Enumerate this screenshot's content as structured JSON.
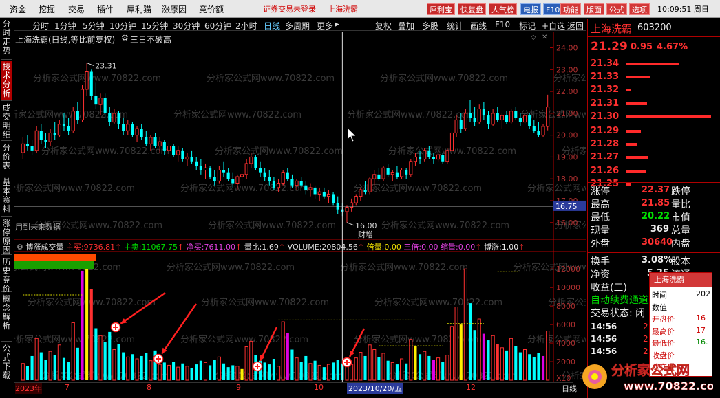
{
  "menubar": {
    "items": [
      "资金",
      "挖掘",
      "交易",
      "插件",
      "犀利猫",
      "涨原因",
      "竞价额"
    ],
    "warning": "证券交易未登录",
    "stock_link": "上海洗霸",
    "tool_buttons": [
      "犀利宝",
      "快复盘",
      "人气榜",
      "电报",
      "F10",
      "功能",
      "版面",
      "公式",
      "选项"
    ],
    "time": "10:09:51 周日"
  },
  "left_tabs": [
    "分时走势",
    "技术分析",
    "成交明细",
    "分价表",
    "基本资料",
    "涨停原因",
    "历史竞价",
    "概念解析",
    "公式下载"
  ],
  "left_tab_active": 1,
  "period_bar": {
    "periods": [
      "分时",
      "1分钟",
      "5分钟",
      "10分钟",
      "15分钟",
      "30分钟",
      "60分钟",
      "2小时",
      "日线",
      "多周期",
      "更多"
    ],
    "selected": "日线",
    "more_arrow": "▶",
    "right_items": [
      "复权",
      "叠加",
      "多股",
      "统计",
      "画线",
      "F10",
      "标记",
      "+自选",
      "返回"
    ]
  },
  "chart_header": {
    "title": "上海洗霸(日线,等比前复权)",
    "indicator": "三日不破高"
  },
  "right_panel": {
    "name": "上海洗霸",
    "code": "603200",
    "price": "21.29",
    "change": "0.95",
    "change_pct": "4.67%",
    "order_book": [
      {
        "price": "21.34",
        "bar": 0.6,
        "kind": "ask"
      },
      {
        "price": "21.33",
        "bar": 0.28,
        "kind": "ask"
      },
      {
        "price": "21.32",
        "bar": 0.06,
        "kind": "ask"
      },
      {
        "price": "21.31",
        "bar": 0.24,
        "kind": "ask"
      },
      {
        "price": "21.30",
        "bar": 0.95,
        "kind": "ask"
      },
      {
        "price": "21.29",
        "bar": 0.17,
        "kind": "bid"
      },
      {
        "price": "21.28",
        "bar": 0.12,
        "kind": "bid"
      },
      {
        "price": "21.27",
        "bar": 0.25,
        "kind": "bid"
      },
      {
        "price": "21.26",
        "bar": 0.22,
        "kind": "bid"
      },
      {
        "price": "21.25",
        "bar": 0.05,
        "kind": "bid"
      }
    ],
    "stats": [
      {
        "l1": "涨停",
        "v1": "22.37",
        "c1": "red",
        "l2": "跌停"
      },
      {
        "l1": "最高",
        "v1": "21.85",
        "c1": "red",
        "l2": "量比"
      },
      {
        "l1": "最低",
        "v1": "20.22",
        "c1": "green",
        "l2": "市值"
      },
      {
        "l1": "现量",
        "v1": "369",
        "c1": "white",
        "l2": "总量"
      },
      {
        "l1": "外盘",
        "v1": "30640",
        "c1": "red",
        "l2": "内盘"
      }
    ],
    "stats2": [
      {
        "l1": "换手",
        "v1": "3.08%",
        "l2": "股本"
      },
      {
        "l1": "净资",
        "v1": "5.35",
        "l2": "流通"
      },
      {
        "l1": "收益(三)",
        "v1": "0",
        "l2": ""
      }
    ],
    "notice": "自动续费通道",
    "trade_state": "交易状态: 闭",
    "ticks": [
      "14:56",
      "14:56",
      "14:56"
    ],
    "tick_vals": [
      "2",
      "2",
      "2"
    ]
  },
  "popup": {
    "title": "上海洗霸",
    "rows": [
      {
        "label": "时间",
        "value": "202"
      },
      {
        "label": "数值",
        "value": ""
      },
      {
        "label": "开盘价",
        "value": "16"
      },
      {
        "label": "最高价",
        "value": "17"
      },
      {
        "label": "最低价",
        "value": "16."
      },
      {
        "label": "收盘价",
        "value": ""
      },
      {
        "label": "成交量",
        "value": ""
      }
    ]
  },
  "main_chart": {
    "yticks": [
      "24.00",
      "23.00",
      "22.00",
      "21.00",
      "20.00",
      "19.00",
      "18.00",
      "17.00",
      "16.00"
    ],
    "high_label": "23.31",
    "low_label": "16.00",
    "crosshair_price": "16.75",
    "event_label": "财增",
    "future_note": "用到未来数据",
    "watermark": "分析家公式网www.70822.com"
  },
  "vol_header": {
    "name": "博涨成交量",
    "main_buy_label": "主买:",
    "main_buy": "9736.81",
    "main_sell_label": "主卖:",
    "main_sell": "11067.75",
    "net_buy_label": "净买:",
    "net_buy": "7611.00",
    "ratio_label": "量比:",
    "ratio": "1.69",
    "volume_label": "VOLUME:",
    "volume": "20804.56",
    "bei_label": "倍量:",
    "bei": "0.00",
    "san_label": "三倍:",
    "san": "0.00",
    "suo_label": "缩量:",
    "suo": "0.00",
    "bo_label": "博涨:",
    "bo": "1.00"
  },
  "vol_axis": {
    "ticks": [
      "12000",
      "10000",
      "8000",
      "6000",
      "4000",
      "2000"
    ],
    "unit": "X10"
  },
  "time_axis": {
    "labels": [
      "2023年",
      "7",
      "8",
      "9",
      "10",
      "12"
    ],
    "cross_date": "2023/10/20/五",
    "right_label": "日线"
  },
  "logo_text": "分析家公式网",
  "logo_url": "www.70822.com",
  "chart_data": {
    "type": "candlestick",
    "title": "上海洗霸(日线,等比前复权)",
    "ylim": [
      15.3,
      24.3
    ],
    "vol_ylim": [
      0,
      13500
    ],
    "candles": [
      {
        "o": 19.2,
        "h": 19.9,
        "l": 18.9,
        "c": 19.6,
        "v": 1800
      },
      {
        "o": 19.6,
        "h": 20.0,
        "l": 19.3,
        "c": 19.5,
        "v": 1500
      },
      {
        "o": 19.5,
        "h": 19.8,
        "l": 19.1,
        "c": 19.3,
        "v": 2600
      },
      {
        "o": 19.3,
        "h": 20.4,
        "l": 19.2,
        "c": 20.2,
        "v": 4500
      },
      {
        "o": 20.2,
        "h": 20.5,
        "l": 19.6,
        "c": 19.8,
        "v": 3000
      },
      {
        "o": 19.8,
        "h": 20.1,
        "l": 19.4,
        "c": 19.7,
        "v": 2200
      },
      {
        "o": 19.7,
        "h": 20.3,
        "l": 19.5,
        "c": 20.1,
        "v": 3100
      },
      {
        "o": 20.1,
        "h": 20.6,
        "l": 19.8,
        "c": 20.0,
        "v": 2700
      },
      {
        "o": 20.0,
        "h": 20.7,
        "l": 19.9,
        "c": 20.5,
        "v": 3800
      },
      {
        "o": 20.5,
        "h": 21.0,
        "l": 20.2,
        "c": 20.4,
        "v": 2400
      },
      {
        "o": 20.4,
        "h": 20.8,
        "l": 20.0,
        "c": 20.2,
        "v": 2000
      },
      {
        "o": 20.2,
        "h": 21.3,
        "l": 20.1,
        "c": 21.1,
        "v": 6200
      },
      {
        "o": 21.1,
        "h": 21.5,
        "l": 20.5,
        "c": 20.7,
        "v": 3500
      },
      {
        "o": 20.7,
        "h": 22.3,
        "l": 20.6,
        "c": 22.1,
        "v": 11800
      },
      {
        "o": 22.1,
        "h": 23.31,
        "l": 21.8,
        "c": 22.9,
        "v": 13000
      },
      {
        "o": 22.9,
        "h": 23.0,
        "l": 21.6,
        "c": 21.8,
        "v": 9800
      },
      {
        "o": 21.8,
        "h": 22.4,
        "l": 21.2,
        "c": 21.4,
        "v": 5600
      },
      {
        "o": 21.4,
        "h": 21.9,
        "l": 20.9,
        "c": 21.7,
        "v": 4800
      },
      {
        "o": 21.7,
        "h": 21.9,
        "l": 20.8,
        "c": 21.0,
        "v": 4100
      },
      {
        "o": 21.0,
        "h": 21.3,
        "l": 20.4,
        "c": 20.6,
        "v": 5200
      },
      {
        "o": 20.6,
        "h": 21.2,
        "l": 20.5,
        "c": 21.0,
        "v": 3300
      },
      {
        "o": 21.0,
        "h": 21.1,
        "l": 20.3,
        "c": 20.5,
        "v": 3900
      },
      {
        "o": 20.5,
        "h": 20.8,
        "l": 20.0,
        "c": 20.2,
        "v": 3000
      },
      {
        "o": 20.2,
        "h": 20.7,
        "l": 20.0,
        "c": 20.5,
        "v": 2500
      },
      {
        "o": 20.5,
        "h": 20.6,
        "l": 19.9,
        "c": 20.0,
        "v": 2800
      },
      {
        "o": 20.0,
        "h": 20.4,
        "l": 19.7,
        "c": 20.3,
        "v": 2300
      },
      {
        "o": 20.3,
        "h": 20.5,
        "l": 19.8,
        "c": 19.9,
        "v": 2600
      },
      {
        "o": 19.9,
        "h": 20.2,
        "l": 19.5,
        "c": 19.6,
        "v": 2900
      },
      {
        "o": 19.6,
        "h": 20.0,
        "l": 19.3,
        "c": 19.9,
        "v": 2100
      },
      {
        "o": 19.9,
        "h": 20.1,
        "l": 19.4,
        "c": 19.5,
        "v": 3200
      },
      {
        "o": 19.5,
        "h": 19.9,
        "l": 19.2,
        "c": 19.7,
        "v": 1700
      },
      {
        "o": 19.7,
        "h": 19.8,
        "l": 19.1,
        "c": 19.3,
        "v": 1900
      },
      {
        "o": 19.3,
        "h": 19.7,
        "l": 19.0,
        "c": 19.5,
        "v": 1600
      },
      {
        "o": 19.5,
        "h": 19.6,
        "l": 19.0,
        "c": 19.1,
        "v": 2000
      },
      {
        "o": 19.1,
        "h": 19.5,
        "l": 18.8,
        "c": 19.3,
        "v": 1400
      },
      {
        "o": 19.3,
        "h": 19.4,
        "l": 18.8,
        "c": 18.9,
        "v": 1800
      },
      {
        "o": 18.9,
        "h": 19.2,
        "l": 18.6,
        "c": 19.0,
        "v": 1500
      },
      {
        "o": 19.0,
        "h": 19.3,
        "l": 18.7,
        "c": 18.8,
        "v": 1300
      },
      {
        "o": 18.8,
        "h": 19.0,
        "l": 18.4,
        "c": 18.6,
        "v": 1700
      },
      {
        "o": 18.6,
        "h": 18.9,
        "l": 18.2,
        "c": 18.4,
        "v": 2100
      },
      {
        "o": 18.4,
        "h": 18.7,
        "l": 18.0,
        "c": 18.5,
        "v": 1900
      },
      {
        "o": 18.5,
        "h": 18.6,
        "l": 18.0,
        "c": 18.1,
        "v": 1600
      },
      {
        "o": 18.1,
        "h": 18.4,
        "l": 17.7,
        "c": 17.9,
        "v": 2200
      },
      {
        "o": 17.9,
        "h": 18.6,
        "l": 17.8,
        "c": 18.4,
        "v": 2500
      },
      {
        "o": 18.4,
        "h": 18.8,
        "l": 18.1,
        "c": 18.3,
        "v": 1800
      },
      {
        "o": 18.3,
        "h": 18.5,
        "l": 17.9,
        "c": 18.0,
        "v": 1400
      },
      {
        "o": 18.0,
        "h": 18.3,
        "l": 17.6,
        "c": 17.8,
        "v": 1600
      },
      {
        "o": 17.8,
        "h": 18.2,
        "l": 17.5,
        "c": 18.1,
        "v": 1500
      },
      {
        "o": 18.1,
        "h": 18.4,
        "l": 17.9,
        "c": 18.2,
        "v": 1200
      },
      {
        "o": 18.2,
        "h": 18.9,
        "l": 18.0,
        "c": 18.7,
        "v": 3600
      },
      {
        "o": 18.7,
        "h": 19.2,
        "l": 18.5,
        "c": 19.0,
        "v": 4200
      },
      {
        "o": 19.0,
        "h": 19.1,
        "l": 18.4,
        "c": 18.5,
        "v": 2700
      },
      {
        "o": 18.5,
        "h": 18.8,
        "l": 18.1,
        "c": 18.3,
        "v": 2100
      },
      {
        "o": 18.3,
        "h": 18.5,
        "l": 17.9,
        "c": 18.1,
        "v": 1900
      },
      {
        "o": 18.1,
        "h": 18.4,
        "l": 17.7,
        "c": 17.9,
        "v": 1700
      },
      {
        "o": 17.9,
        "h": 18.1,
        "l": 17.5,
        "c": 17.6,
        "v": 2300
      },
      {
        "o": 17.6,
        "h": 18.0,
        "l": 17.4,
        "c": 17.8,
        "v": 1500
      },
      {
        "o": 17.8,
        "h": 18.4,
        "l": 17.7,
        "c": 18.3,
        "v": 6300
      },
      {
        "o": 18.3,
        "h": 18.5,
        "l": 17.9,
        "c": 18.0,
        "v": 5100
      },
      {
        "o": 18.0,
        "h": 18.2,
        "l": 17.6,
        "c": 17.7,
        "v": 3300
      },
      {
        "o": 17.7,
        "h": 18.0,
        "l": 17.5,
        "c": 17.9,
        "v": 2400
      },
      {
        "o": 17.9,
        "h": 18.1,
        "l": 17.6,
        "c": 17.7,
        "v": 2000
      },
      {
        "o": 17.7,
        "h": 17.9,
        "l": 17.3,
        "c": 17.5,
        "v": 2600
      },
      {
        "o": 17.5,
        "h": 17.8,
        "l": 17.2,
        "c": 17.6,
        "v": 1800
      },
      {
        "o": 17.6,
        "h": 17.7,
        "l": 17.1,
        "c": 17.3,
        "v": 2100
      },
      {
        "o": 17.3,
        "h": 17.6,
        "l": 17.0,
        "c": 17.4,
        "v": 1600
      },
      {
        "o": 17.4,
        "h": 17.6,
        "l": 17.1,
        "c": 17.2,
        "v": 1400
      },
      {
        "o": 17.2,
        "h": 17.5,
        "l": 16.9,
        "c": 17.3,
        "v": 1700
      },
      {
        "o": 17.3,
        "h": 17.4,
        "l": 16.8,
        "c": 16.9,
        "v": 1900
      },
      {
        "o": 16.9,
        "h": 17.2,
        "l": 16.4,
        "c": 16.6,
        "v": 2200
      },
      {
        "o": 16.6,
        "h": 16.9,
        "l": 16.3,
        "c": 16.5,
        "v": 1800
      },
      {
        "o": 16.5,
        "h": 16.8,
        "l": 16.0,
        "c": 16.7,
        "v": 2000
      },
      {
        "o": 16.7,
        "h": 17.1,
        "l": 16.5,
        "c": 16.9,
        "v": 1700
      },
      {
        "o": 16.9,
        "h": 17.3,
        "l": 16.8,
        "c": 17.2,
        "v": 2400
      },
      {
        "o": 17.2,
        "h": 17.6,
        "l": 17.0,
        "c": 17.5,
        "v": 3000
      },
      {
        "o": 17.5,
        "h": 17.9,
        "l": 17.3,
        "c": 17.4,
        "v": 2600
      },
      {
        "o": 17.4,
        "h": 18.1,
        "l": 17.3,
        "c": 18.0,
        "v": 3800
      },
      {
        "o": 18.0,
        "h": 18.4,
        "l": 17.7,
        "c": 18.2,
        "v": 3300
      },
      {
        "o": 18.2,
        "h": 18.5,
        "l": 17.9,
        "c": 18.0,
        "v": 2500
      },
      {
        "o": 18.0,
        "h": 18.6,
        "l": 17.9,
        "c": 18.5,
        "v": 2900
      },
      {
        "o": 18.5,
        "h": 18.7,
        "l": 18.1,
        "c": 18.2,
        "v": 2100
      },
      {
        "o": 18.2,
        "h": 18.4,
        "l": 17.9,
        "c": 18.3,
        "v": 1900
      },
      {
        "o": 18.3,
        "h": 18.6,
        "l": 18.0,
        "c": 18.1,
        "v": 1700
      },
      {
        "o": 18.1,
        "h": 18.5,
        "l": 18.0,
        "c": 18.4,
        "v": 2300
      },
      {
        "o": 18.4,
        "h": 18.5,
        "l": 18.0,
        "c": 18.2,
        "v": 1800
      },
      {
        "o": 18.2,
        "h": 18.9,
        "l": 18.1,
        "c": 18.8,
        "v": 4400
      },
      {
        "o": 18.8,
        "h": 19.2,
        "l": 18.6,
        "c": 19.0,
        "v": 3700
      },
      {
        "o": 19.0,
        "h": 19.3,
        "l": 18.7,
        "c": 18.9,
        "v": 2800
      },
      {
        "o": 18.9,
        "h": 19.4,
        "l": 18.8,
        "c": 19.3,
        "v": 3100
      },
      {
        "o": 19.3,
        "h": 19.5,
        "l": 18.9,
        "c": 19.0,
        "v": 2600
      },
      {
        "o": 19.0,
        "h": 19.2,
        "l": 18.7,
        "c": 18.9,
        "v": 2200
      },
      {
        "o": 18.9,
        "h": 19.3,
        "l": 18.8,
        "c": 19.1,
        "v": 2400
      },
      {
        "o": 19.1,
        "h": 19.2,
        "l": 18.7,
        "c": 18.8,
        "v": 2000
      },
      {
        "o": 18.8,
        "h": 19.4,
        "l": 18.7,
        "c": 19.3,
        "v": 2700
      },
      {
        "o": 19.3,
        "h": 20.2,
        "l": 19.2,
        "c": 20.1,
        "v": 5800
      },
      {
        "o": 20.1,
        "h": 20.9,
        "l": 19.9,
        "c": 20.7,
        "v": 7900
      },
      {
        "o": 20.7,
        "h": 21.0,
        "l": 20.1,
        "c": 20.3,
        "v": 6000
      },
      {
        "o": 20.3,
        "h": 21.2,
        "l": 20.2,
        "c": 21.0,
        "v": 12000
      },
      {
        "o": 21.0,
        "h": 21.6,
        "l": 20.6,
        "c": 20.8,
        "v": 8300
      },
      {
        "o": 20.8,
        "h": 21.3,
        "l": 20.4,
        "c": 20.6,
        "v": 5400
      },
      {
        "o": 20.6,
        "h": 21.4,
        "l": 20.5,
        "c": 21.2,
        "v": 6600
      },
      {
        "o": 21.2,
        "h": 21.5,
        "l": 20.7,
        "c": 20.9,
        "v": 5000
      },
      {
        "o": 20.9,
        "h": 21.1,
        "l": 20.3,
        "c": 20.5,
        "v": 4300
      },
      {
        "o": 20.5,
        "h": 21.2,
        "l": 20.4,
        "c": 21.0,
        "v": 4800
      },
      {
        "o": 21.0,
        "h": 21.3,
        "l": 20.6,
        "c": 20.7,
        "v": 3900
      },
      {
        "o": 20.7,
        "h": 21.0,
        "l": 20.3,
        "c": 20.9,
        "v": 3500
      },
      {
        "o": 20.9,
        "h": 21.1,
        "l": 20.5,
        "c": 20.6,
        "v": 3200
      },
      {
        "o": 20.6,
        "h": 21.2,
        "l": 20.5,
        "c": 21.1,
        "v": 4500
      },
      {
        "o": 21.1,
        "h": 21.3,
        "l": 20.7,
        "c": 20.8,
        "v": 3700
      },
      {
        "o": 20.8,
        "h": 21.0,
        "l": 20.4,
        "c": 20.6,
        "v": 3000
      },
      {
        "o": 20.6,
        "h": 21.1,
        "l": 20.5,
        "c": 20.9,
        "v": 3300
      },
      {
        "o": 20.9,
        "h": 21.0,
        "l": 20.3,
        "c": 20.4,
        "v": 2800
      },
      {
        "o": 20.4,
        "h": 20.7,
        "l": 20.1,
        "c": 20.2,
        "v": 2500
      },
      {
        "o": 20.2,
        "h": 20.6,
        "l": 19.9,
        "c": 20.0,
        "v": 2900
      },
      {
        "o": 20.0,
        "h": 20.5,
        "l": 19.9,
        "c": 20.4,
        "v": 2600
      },
      {
        "o": 20.4,
        "h": 21.85,
        "l": 20.22,
        "c": 21.29,
        "v": 5300
      }
    ]
  }
}
